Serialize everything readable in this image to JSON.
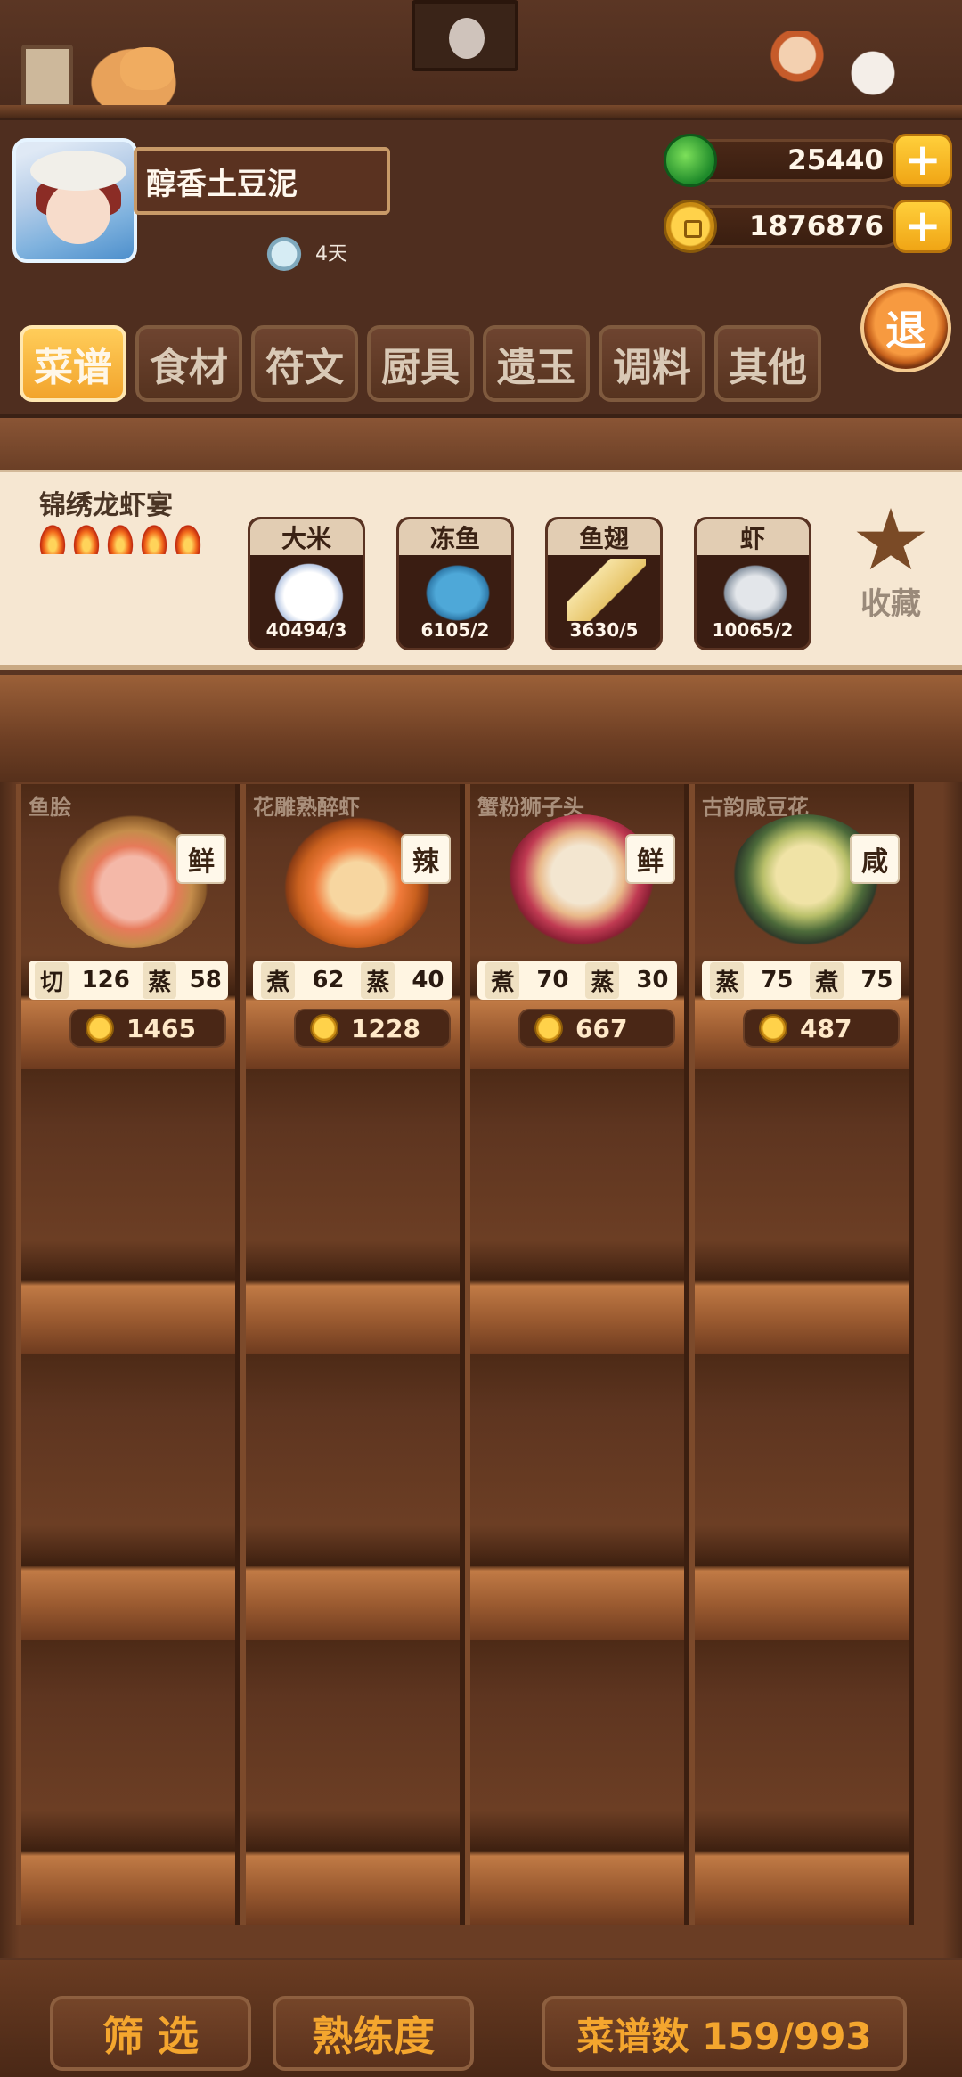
{
  "player": {
    "name": "醇香土豆泥",
    "days": "4天"
  },
  "currency": {
    "jade": "25440",
    "coins": "1876876",
    "plus_label": "+"
  },
  "exit_label": "退",
  "tabs": [
    {
      "label": "菜谱",
      "active": true
    },
    {
      "label": "食材",
      "active": false
    },
    {
      "label": "符文",
      "active": false
    },
    {
      "label": "厨具",
      "active": false
    },
    {
      "label": "遗玉",
      "active": false
    },
    {
      "label": "调料",
      "active": false
    },
    {
      "label": "其他",
      "active": false
    }
  ],
  "recipe": {
    "title": "锦绣龙虾宴",
    "flames": 5,
    "ingredients": [
      {
        "name": "大米",
        "qty": "40494/3",
        "icon": "rice-icon"
      },
      {
        "name": "冻鱼",
        "qty": "6105/2",
        "icon": "fish-icon"
      },
      {
        "name": "鱼翅",
        "qty": "3630/5",
        "icon": "fin-icon"
      },
      {
        "name": "虾",
        "qty": "10065/2",
        "icon": "shrimp-icon"
      }
    ],
    "favorite_label": "收藏"
  },
  "dishes": [
    {
      "name": "鱼脍",
      "taste": "鲜",
      "s1": "切",
      "v1": "126",
      "s2": "蒸",
      "v2": "58",
      "price": "1465"
    },
    {
      "name": "花雕熟醉虾",
      "taste": "辣",
      "s1": "煮",
      "v1": "62",
      "s2": "蒸",
      "v2": "40",
      "price": "1228"
    },
    {
      "name": "蟹粉狮子头",
      "taste": "鲜",
      "s1": "煮",
      "v1": "70",
      "s2": "蒸",
      "v2": "30",
      "price": "667"
    },
    {
      "name": "古韵咸豆花",
      "taste": "咸",
      "s1": "蒸",
      "v1": "75",
      "s2": "煮",
      "v2": "75",
      "price": "487"
    }
  ],
  "bottom": {
    "filter_label": "筛  选",
    "proficiency_label": "熟练度",
    "recipe_count": "菜谱数 159/993"
  }
}
